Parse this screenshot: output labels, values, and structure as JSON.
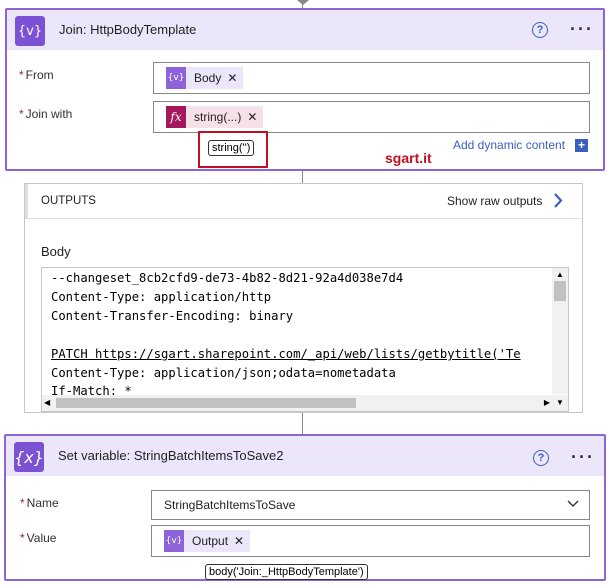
{
  "join_action": {
    "title": "Join: HttpBodyTemplate",
    "icon": "{v}",
    "from_label": "From",
    "from_token": "Body",
    "join_with_label": "Join with",
    "join_with_token": "string(...)",
    "join_with_token_icon": "fx",
    "tooltip": "string('')",
    "add_dynamic_label": "Add dynamic content",
    "watermark": "sgart.it"
  },
  "outputs": {
    "header": "OUTPUTS",
    "show_raw": "Show raw outputs",
    "body_label": "Body",
    "lines": [
      "--changeset_8cb2cfd9-de73-4b82-8d21-92a4d038e7d4",
      "Content-Type: application/http",
      "Content-Transfer-Encoding: binary",
      "",
      "PATCH https://sgart.sharepoint.com/_api/web/lists/getbytitle('Te",
      "Content-Type: application/json;odata=nometadata",
      "If-Match: *"
    ]
  },
  "set_variable": {
    "title": "Set variable: StringBatchItemsToSave2",
    "icon": "{x}",
    "name_label": "Name",
    "name_value": "StringBatchItemsToSave",
    "value_label": "Value",
    "value_token": "Output",
    "tooltip": "body('Join:_HttpBodyTemplate')"
  },
  "colors": {
    "accent": "#7b52d3",
    "header_bg": "#ece6fa",
    "expression": "#a3195b",
    "link": "#3b5fc0",
    "required": "#a4262c",
    "watermark": "#c50f1f"
  }
}
